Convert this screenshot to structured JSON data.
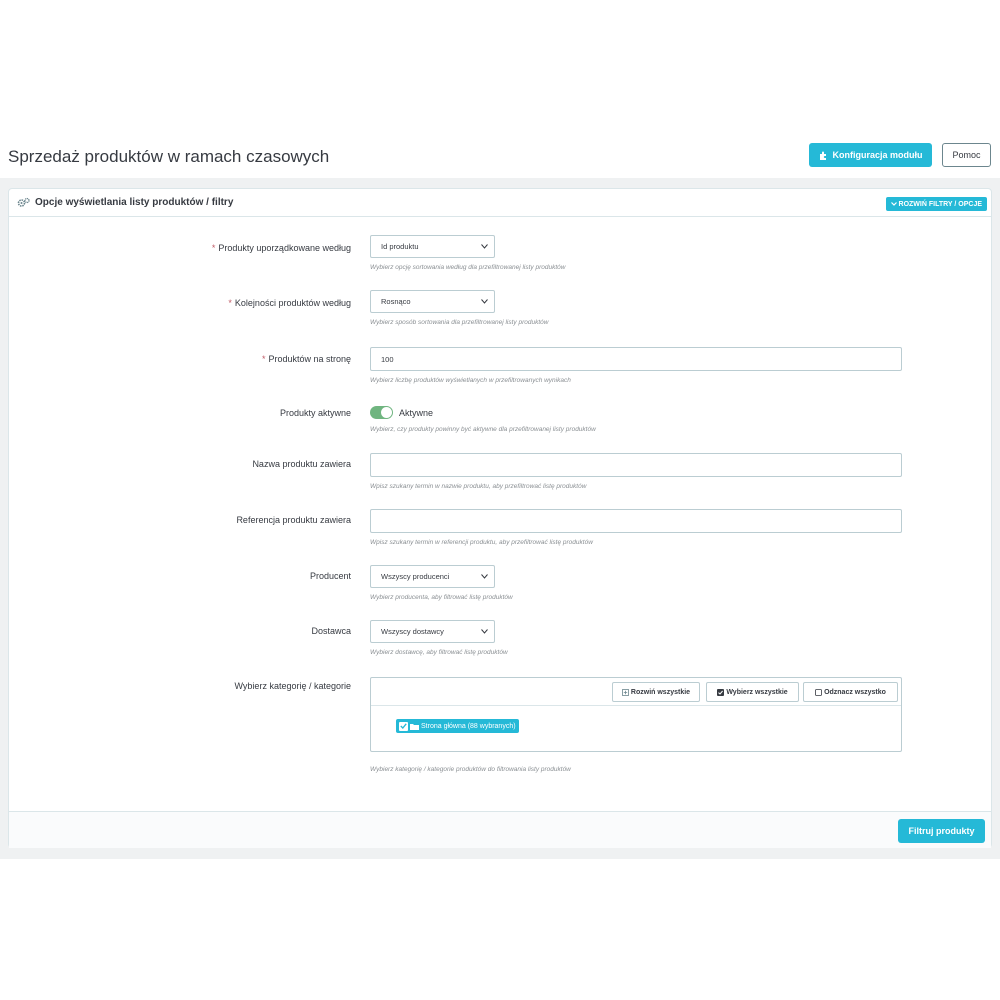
{
  "header": {
    "title": "Sprzedaż produktów w ramach czasowych",
    "config_button": "Konfiguracja modułu",
    "help_button": "Pomoc"
  },
  "panel": {
    "title": "Opcje wyświetlania listy produktów / filtry",
    "expand_button": "ROZWIŃ FILTRY / OPCJE"
  },
  "fields": {
    "order_by": {
      "label": "Produkty uporządkowane według",
      "value": "Id produktu",
      "help": "Wybierz opcję sortowania według dla przefiltrowanej listy produktów"
    },
    "order_dir": {
      "label": "Kolejności produktów według",
      "value": "Rosnąco",
      "help": "Wybierz sposób sortowania dla przefiltrowanej listy produktów"
    },
    "per_page": {
      "label": "Produktów na stronę",
      "value": "100",
      "help": "Wybierz liczbę produktów wyświetlanych w przefiltrowanych wynikach"
    },
    "active": {
      "label": "Produkty aktywne",
      "value": "Aktywne",
      "help": "Wybierz, czy produkty powinny być aktywne dla przefiltrowanej listy produktów"
    },
    "name_contains": {
      "label": "Nazwa produktu zawiera",
      "value": "",
      "help": "Wpisz szukany termin w nazwie produktu, aby przefiltrować listę produktów"
    },
    "ref_contains": {
      "label": "Referencja produktu zawiera",
      "value": "",
      "help": "Wpisz szukany termin w referencji produktu, aby przefiltrować listę produktów"
    },
    "manufacturer": {
      "label": "Producent",
      "value": "Wszyscy producenci",
      "help": "Wybierz producenta, aby filtrować listę produktów"
    },
    "supplier": {
      "label": "Dostawca",
      "value": "Wszyscy dostawcy",
      "help": "Wybierz dostawcę, aby filtrować listę produktów"
    },
    "categories": {
      "label": "Wybierz kategorię / kategorie",
      "expand_all": "Rozwiń wszystkie",
      "select_all": "Wybierz wszystkie",
      "deselect_all": "Odznacz wszystko",
      "root_node": "Strona główna (88 wybranych)",
      "help": "Wybierz kategorię / kategorie produktów do filtrowania listy produktów"
    }
  },
  "footer": {
    "submit": "Filtruj produkty"
  },
  "colors": {
    "accent": "#25b9d7",
    "switch_on": "#70b580",
    "required": "#c05c67"
  }
}
